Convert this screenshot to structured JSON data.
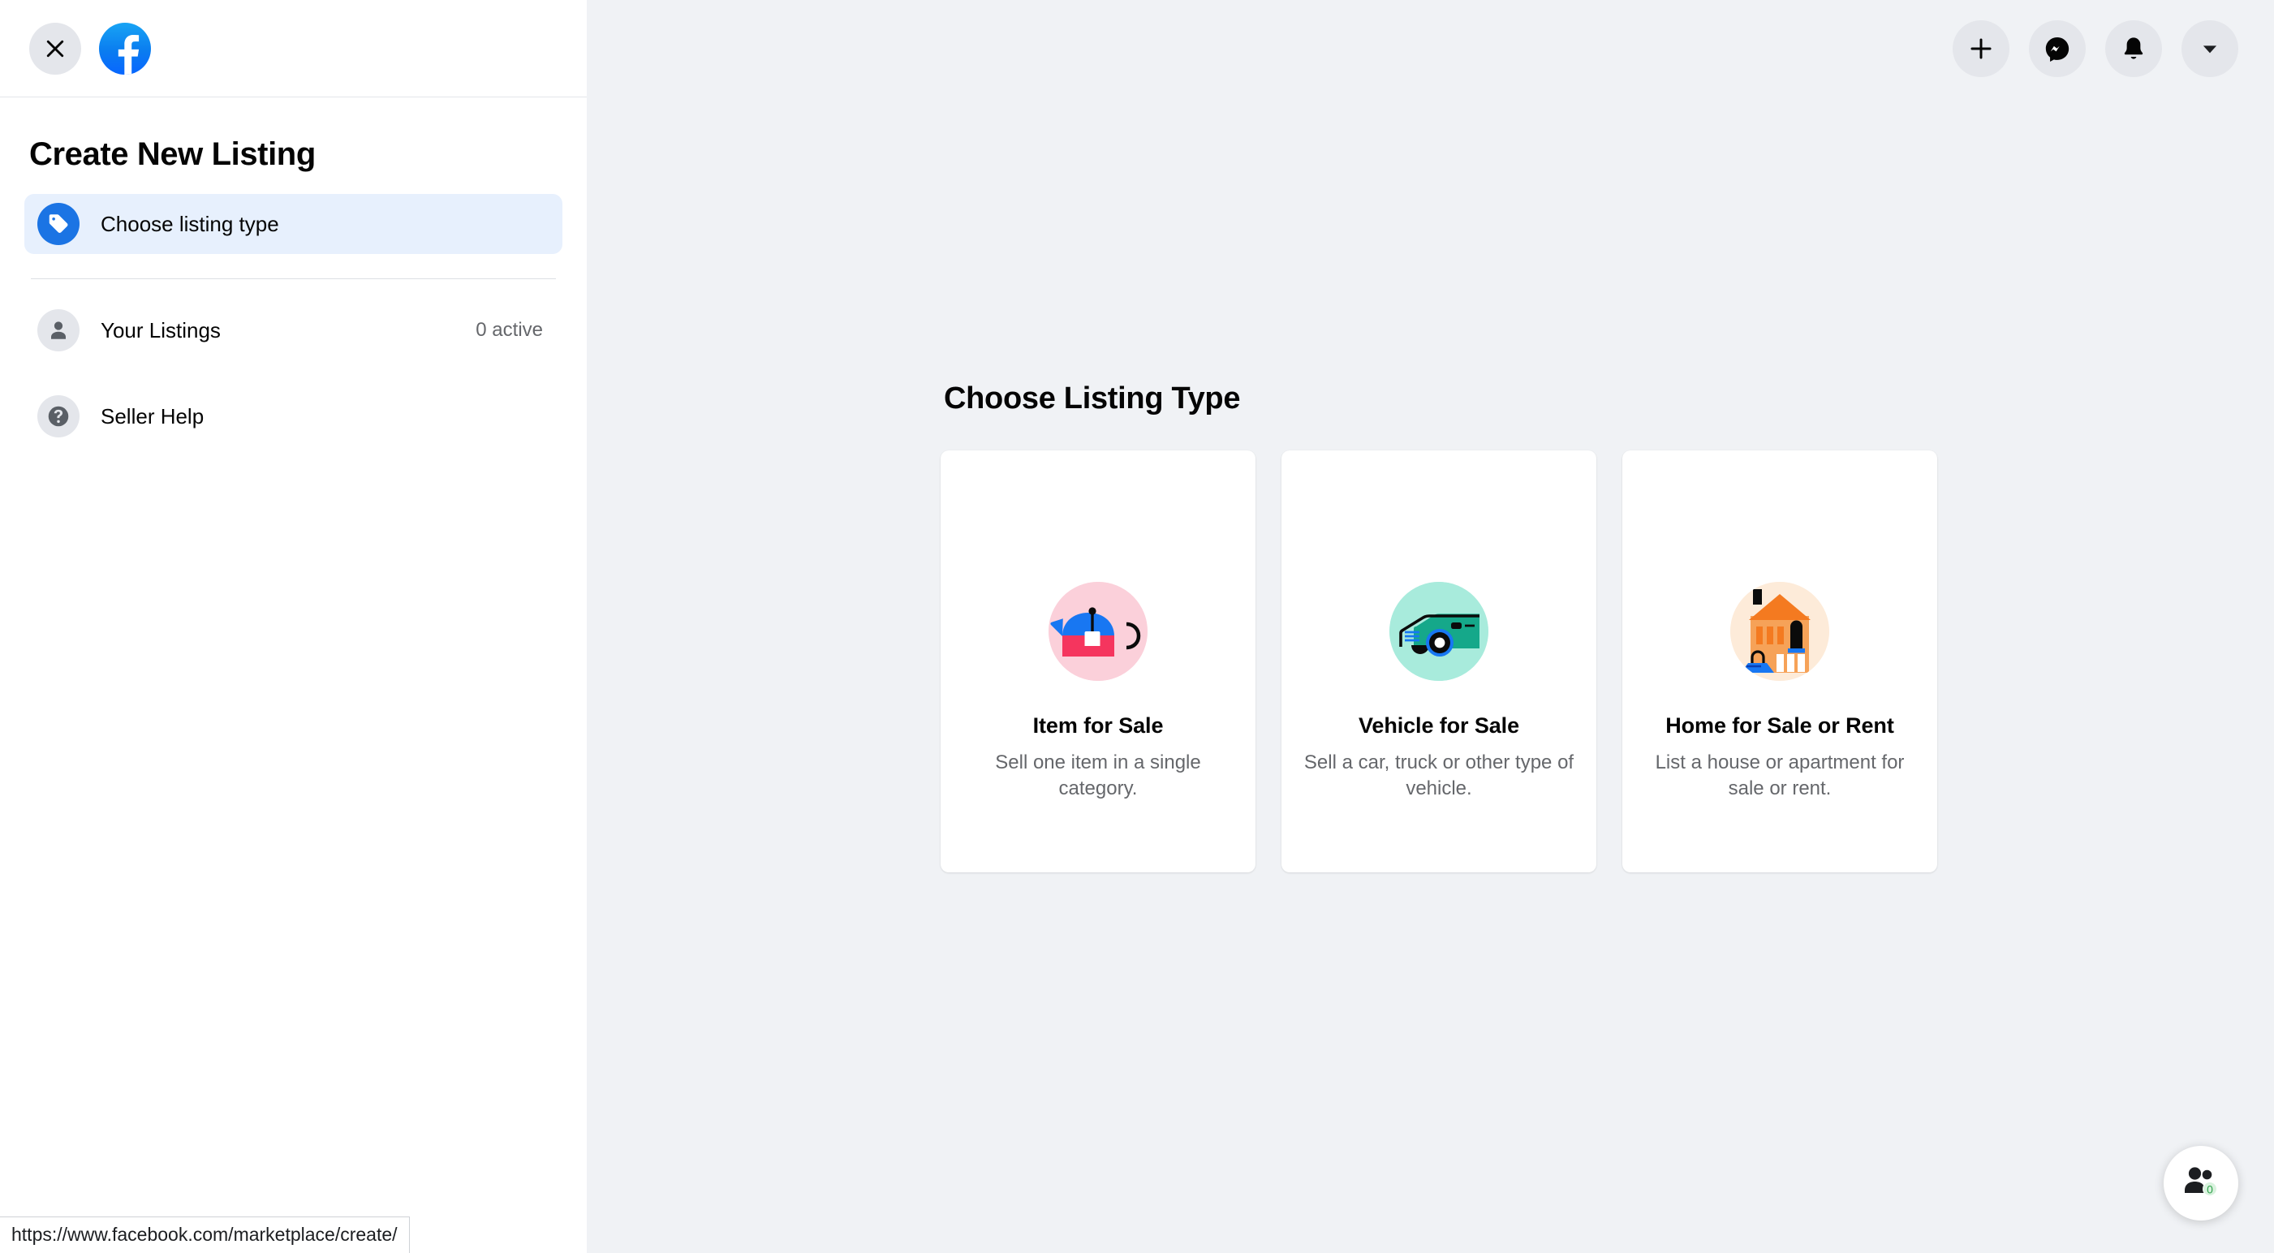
{
  "sidebar": {
    "close_icon": "close-icon",
    "logo_icon": "facebook-logo",
    "title": "Create New Listing",
    "active_item": {
      "label": "Choose listing type",
      "icon": "price-tag-icon"
    },
    "items": [
      {
        "label": "Your Listings",
        "meta": "0 active",
        "icon": "person-icon"
      },
      {
        "label": "Seller Help",
        "meta": "",
        "icon": "question-mark-icon"
      }
    ]
  },
  "topbar": {
    "buttons": [
      {
        "name": "create-button",
        "icon": "plus-icon"
      },
      {
        "name": "messenger-button",
        "icon": "messenger-icon"
      },
      {
        "name": "notifications-button",
        "icon": "bell-icon"
      },
      {
        "name": "account-menu-button",
        "icon": "chevron-down-icon"
      }
    ]
  },
  "main": {
    "heading": "Choose Listing Type",
    "cards": [
      {
        "title": "Item for Sale",
        "description": "Sell one item in a single category.",
        "icon": "teapot-with-price-tag-illustration",
        "circle_color": "#fbd0da"
      },
      {
        "title": "Vehicle for Sale",
        "description": "Sell a car, truck or other type of vehicle.",
        "icon": "car-illustration",
        "circle_color": "#a8ebdc"
      },
      {
        "title": "Home for Sale or Rent",
        "description": "List a house or apartment for sale or rent.",
        "icon": "house-illustration",
        "circle_color": "#fdebd9"
      }
    ]
  },
  "contacts_fab": {
    "icon": "contacts-icon",
    "badge": "0",
    "badge_color": "#31a24c"
  },
  "statusbar": {
    "url": "https://www.facebook.com/marketplace/create/"
  },
  "colors": {
    "accent": "#1b74e4",
    "page_bg": "#f0f2f5",
    "panel_bg": "#ffffff",
    "active_bg": "#e7f0fd",
    "text_primary": "#050505",
    "text_secondary": "#65676b"
  }
}
